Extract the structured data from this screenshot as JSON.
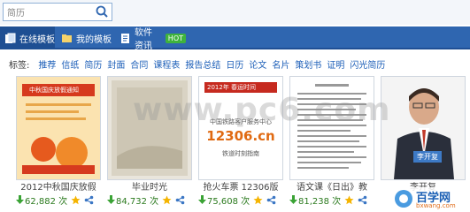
{
  "search": {
    "value": "简历"
  },
  "tabs": [
    {
      "label": "在线模板"
    },
    {
      "label": "我的模板"
    },
    {
      "label": "软件资讯",
      "badge": "HOT"
    }
  ],
  "tags": {
    "label": "标签:",
    "items": [
      "推荐",
      "信纸",
      "简历",
      "封面",
      "合同",
      "课程表",
      "报告总结",
      "日历",
      "论文",
      "名片",
      "策划书",
      "证明",
      "闪光简历"
    ]
  },
  "cards": [
    {
      "title": "2012中秋国庆放假",
      "downloads": "62,882 次",
      "thumb_text": "中秋国庆放假通知"
    },
    {
      "title": "毕业时光",
      "downloads": "84,732 次"
    },
    {
      "title": "抢火车票 12306版",
      "downloads": "75,608 次",
      "thumb_heading": "2012年 春运时间",
      "thumb_sub": "中国铁路客户服务中心",
      "thumb_big": "12306.cn",
      "thumb_foot": "铁道时刻指南"
    },
    {
      "title": "语文课《日出》教",
      "downloads": "81,238 次"
    },
    {
      "title": "李开复",
      "downloads": "",
      "name_tag": "李开复"
    }
  ],
  "watermark": "www.pc6.com",
  "logo": {
    "text": "百学网",
    "sub": "bxwang.com"
  },
  "colors": {
    "tabbar": "#2f66b0",
    "tab_active": "#1e4f93",
    "link": "#1d5fb8",
    "download": "#2b7a1e",
    "hot": "#3fb33c"
  }
}
